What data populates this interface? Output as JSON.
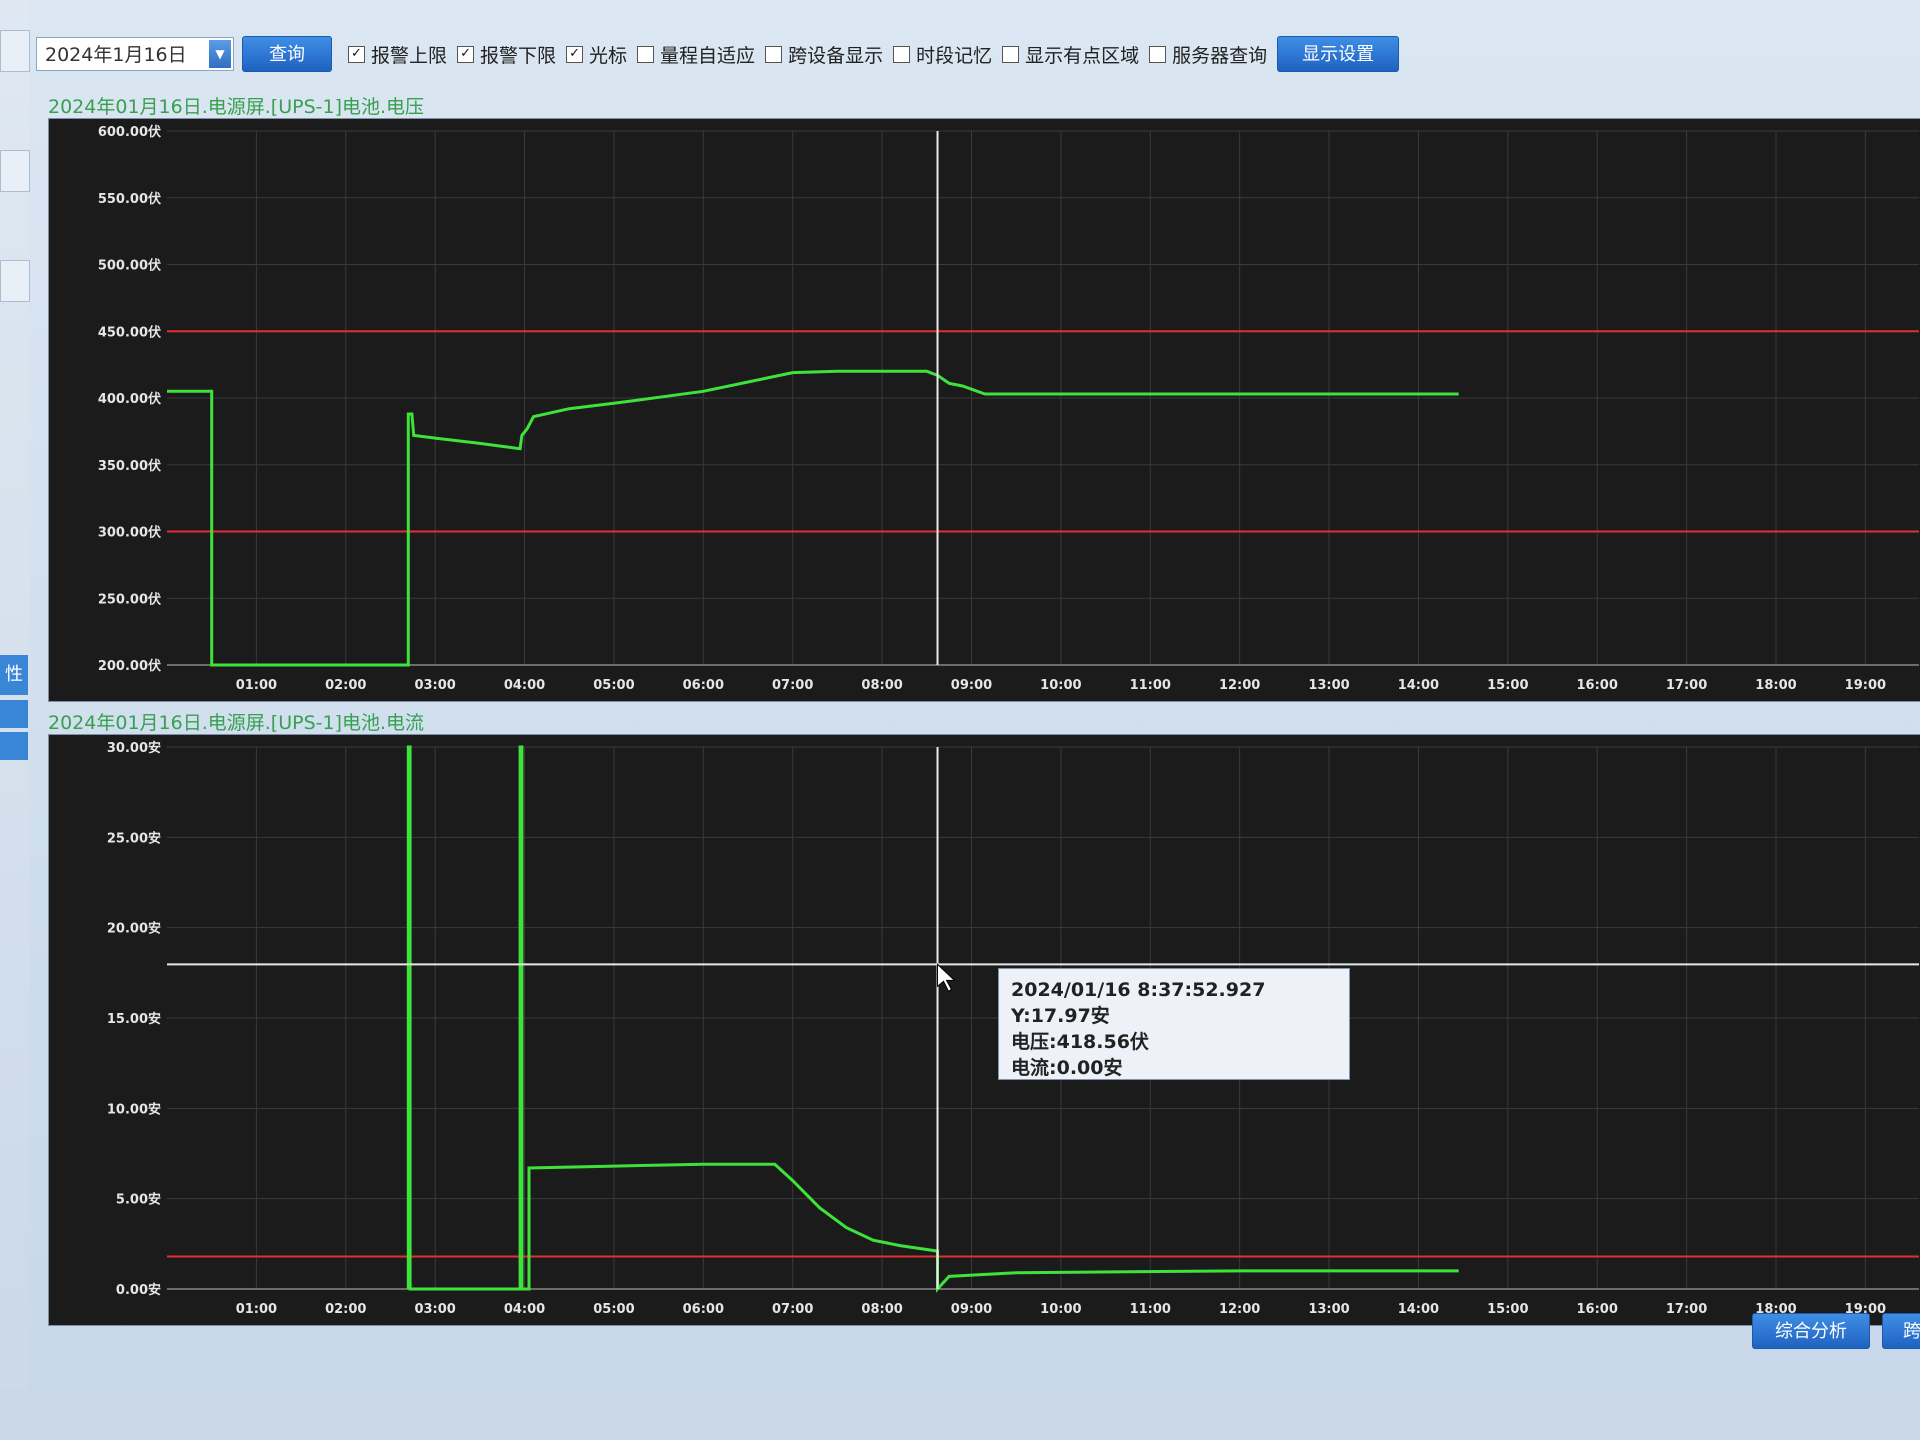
{
  "toolbar": {
    "date_value": "2024年1月16日",
    "query_label": "查询",
    "checkboxes": [
      {
        "label": "报警上限",
        "checked": true
      },
      {
        "label": "报警下限",
        "checked": true
      },
      {
        "label": "光标",
        "checked": true
      },
      {
        "label": "量程自适应",
        "checked": false
      },
      {
        "label": "跨设备显示",
        "checked": false
      },
      {
        "label": "时段记忆",
        "checked": false
      },
      {
        "label": "显示有点区域",
        "checked": false
      },
      {
        "label": "服务器查询",
        "checked": false
      }
    ],
    "display_settings_label": "显示设置"
  },
  "sidebar": {
    "tab_label": "性"
  },
  "chart_data": [
    {
      "type": "line",
      "title": "2024年01月16日.电源屏.[UPS-1]电池.电压",
      "ylim": [
        200,
        600
      ],
      "y_ticks": [
        "600.00伏",
        "550.00伏",
        "500.00伏",
        "450.00伏",
        "400.00伏",
        "350.00伏",
        "300.00伏",
        "250.00伏",
        "200.00伏"
      ],
      "x_ticks": [
        "01:00",
        "02:00",
        "03:00",
        "04:00",
        "05:00",
        "06:00",
        "07:00",
        "08:00",
        "09:00",
        "10:00",
        "11:00",
        "12:00",
        "13:00",
        "14:00",
        "15:00",
        "16:00",
        "17:00",
        "18:00",
        "19:00"
      ],
      "alarm_upper": 450,
      "alarm_lower": 300,
      "series_color": "#3fe23a",
      "alarm_color": "#e03030",
      "points": [
        [
          0.0,
          405
        ],
        [
          0.5,
          405
        ],
        [
          0.5,
          200
        ],
        [
          0.5,
          200
        ],
        [
          2.7,
          200
        ],
        [
          2.7,
          388
        ],
        [
          2.74,
          388
        ],
        [
          2.76,
          372
        ],
        [
          3.0,
          370
        ],
        [
          3.5,
          366
        ],
        [
          3.95,
          362
        ],
        [
          3.97,
          372
        ],
        [
          4.03,
          377
        ],
        [
          4.1,
          386
        ],
        [
          4.5,
          392
        ],
        [
          5.0,
          396
        ],
        [
          6.0,
          405
        ],
        [
          6.5,
          412
        ],
        [
          7.0,
          419
        ],
        [
          7.5,
          420
        ],
        [
          8.5,
          420
        ],
        [
          8.62,
          417
        ],
        [
          8.75,
          411
        ],
        [
          8.9,
          409
        ],
        [
          9.15,
          403
        ],
        [
          10.0,
          403
        ],
        [
          12.0,
          403
        ],
        [
          14.45,
          403
        ]
      ]
    },
    {
      "type": "line",
      "title": "2024年01月16日.电源屏.[UPS-1]电池.电流",
      "ylim": [
        0,
        30
      ],
      "y_ticks": [
        "30.00安",
        "25.00安",
        "20.00安",
        "15.00安",
        "10.00安",
        "5.00安",
        "0.00安"
      ],
      "x_ticks": [
        "01:00",
        "02:00",
        "03:00",
        "04:00",
        "05:00",
        "06:00",
        "07:00",
        "08:00",
        "09:00",
        "10:00",
        "11:00",
        "12:00",
        "13:00",
        "14:00",
        "15:00",
        "16:00",
        "17:00",
        "18:00",
        "19:00"
      ],
      "alarm_lower": 1.8,
      "series_color": "#3fe23a",
      "alarm_color": "#e03030",
      "points": [
        [
          2.7,
          0
        ],
        [
          2.7,
          30
        ],
        [
          2.72,
          30
        ],
        [
          2.72,
          0
        ],
        [
          3.95,
          0
        ],
        [
          3.95,
          30
        ],
        [
          3.97,
          30
        ],
        [
          3.97,
          0
        ],
        [
          4.0,
          0
        ],
        [
          4.05,
          0
        ],
        [
          4.05,
          6.7
        ],
        [
          5.0,
          6.8
        ],
        [
          6.0,
          6.9
        ],
        [
          6.8,
          6.9
        ],
        [
          7.0,
          6.0
        ],
        [
          7.3,
          4.5
        ],
        [
          7.6,
          3.4
        ],
        [
          7.9,
          2.7
        ],
        [
          8.2,
          2.4
        ],
        [
          8.62,
          2.1
        ],
        [
          8.62,
          0
        ],
        [
          8.75,
          0.7
        ],
        [
          9.5,
          0.9
        ],
        [
          12.0,
          1.0
        ],
        [
          14.45,
          1.0
        ]
      ],
      "cursor_y": 17.97
    }
  ],
  "cursor": {
    "time": 8.62
  },
  "tooltip": {
    "line1": "2024/01/16 8:37:52.927 Y:17.97安",
    "line2": "电压:418.56伏",
    "line3": "电流:0.00安"
  },
  "bottom_buttons": [
    "综合分析",
    "跨"
  ]
}
